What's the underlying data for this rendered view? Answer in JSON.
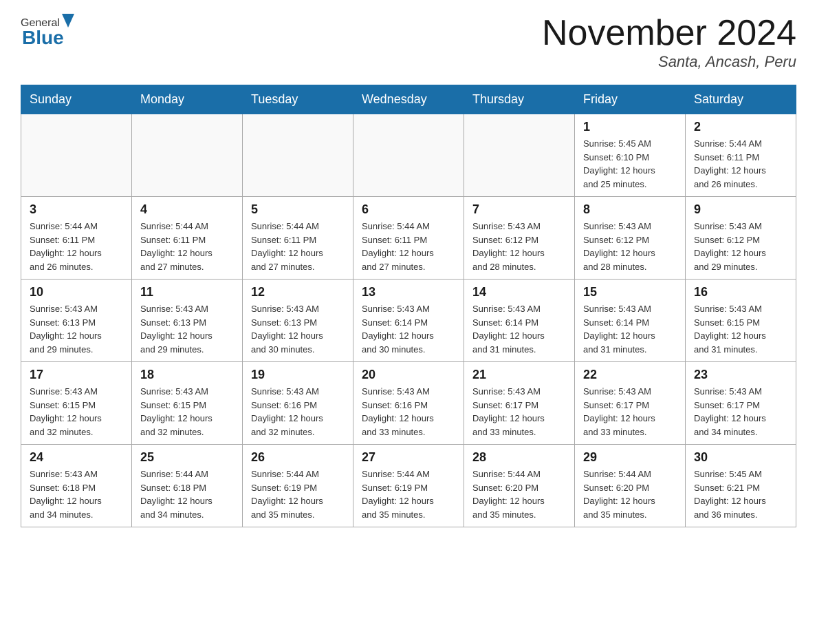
{
  "header": {
    "logo_general": "General",
    "logo_blue": "Blue",
    "month_title": "November 2024",
    "subtitle": "Santa, Ancash, Peru"
  },
  "days_of_week": [
    "Sunday",
    "Monday",
    "Tuesday",
    "Wednesday",
    "Thursday",
    "Friday",
    "Saturday"
  ],
  "weeks": [
    [
      {
        "day": "",
        "info": ""
      },
      {
        "day": "",
        "info": ""
      },
      {
        "day": "",
        "info": ""
      },
      {
        "day": "",
        "info": ""
      },
      {
        "day": "",
        "info": ""
      },
      {
        "day": "1",
        "info": "Sunrise: 5:45 AM\nSunset: 6:10 PM\nDaylight: 12 hours\nand 25 minutes."
      },
      {
        "day": "2",
        "info": "Sunrise: 5:44 AM\nSunset: 6:11 PM\nDaylight: 12 hours\nand 26 minutes."
      }
    ],
    [
      {
        "day": "3",
        "info": "Sunrise: 5:44 AM\nSunset: 6:11 PM\nDaylight: 12 hours\nand 26 minutes."
      },
      {
        "day": "4",
        "info": "Sunrise: 5:44 AM\nSunset: 6:11 PM\nDaylight: 12 hours\nand 27 minutes."
      },
      {
        "day": "5",
        "info": "Sunrise: 5:44 AM\nSunset: 6:11 PM\nDaylight: 12 hours\nand 27 minutes."
      },
      {
        "day": "6",
        "info": "Sunrise: 5:44 AM\nSunset: 6:11 PM\nDaylight: 12 hours\nand 27 minutes."
      },
      {
        "day": "7",
        "info": "Sunrise: 5:43 AM\nSunset: 6:12 PM\nDaylight: 12 hours\nand 28 minutes."
      },
      {
        "day": "8",
        "info": "Sunrise: 5:43 AM\nSunset: 6:12 PM\nDaylight: 12 hours\nand 28 minutes."
      },
      {
        "day": "9",
        "info": "Sunrise: 5:43 AM\nSunset: 6:12 PM\nDaylight: 12 hours\nand 29 minutes."
      }
    ],
    [
      {
        "day": "10",
        "info": "Sunrise: 5:43 AM\nSunset: 6:13 PM\nDaylight: 12 hours\nand 29 minutes."
      },
      {
        "day": "11",
        "info": "Sunrise: 5:43 AM\nSunset: 6:13 PM\nDaylight: 12 hours\nand 29 minutes."
      },
      {
        "day": "12",
        "info": "Sunrise: 5:43 AM\nSunset: 6:13 PM\nDaylight: 12 hours\nand 30 minutes."
      },
      {
        "day": "13",
        "info": "Sunrise: 5:43 AM\nSunset: 6:14 PM\nDaylight: 12 hours\nand 30 minutes."
      },
      {
        "day": "14",
        "info": "Sunrise: 5:43 AM\nSunset: 6:14 PM\nDaylight: 12 hours\nand 31 minutes."
      },
      {
        "day": "15",
        "info": "Sunrise: 5:43 AM\nSunset: 6:14 PM\nDaylight: 12 hours\nand 31 minutes."
      },
      {
        "day": "16",
        "info": "Sunrise: 5:43 AM\nSunset: 6:15 PM\nDaylight: 12 hours\nand 31 minutes."
      }
    ],
    [
      {
        "day": "17",
        "info": "Sunrise: 5:43 AM\nSunset: 6:15 PM\nDaylight: 12 hours\nand 32 minutes."
      },
      {
        "day": "18",
        "info": "Sunrise: 5:43 AM\nSunset: 6:15 PM\nDaylight: 12 hours\nand 32 minutes."
      },
      {
        "day": "19",
        "info": "Sunrise: 5:43 AM\nSunset: 6:16 PM\nDaylight: 12 hours\nand 32 minutes."
      },
      {
        "day": "20",
        "info": "Sunrise: 5:43 AM\nSunset: 6:16 PM\nDaylight: 12 hours\nand 33 minutes."
      },
      {
        "day": "21",
        "info": "Sunrise: 5:43 AM\nSunset: 6:17 PM\nDaylight: 12 hours\nand 33 minutes."
      },
      {
        "day": "22",
        "info": "Sunrise: 5:43 AM\nSunset: 6:17 PM\nDaylight: 12 hours\nand 33 minutes."
      },
      {
        "day": "23",
        "info": "Sunrise: 5:43 AM\nSunset: 6:17 PM\nDaylight: 12 hours\nand 34 minutes."
      }
    ],
    [
      {
        "day": "24",
        "info": "Sunrise: 5:43 AM\nSunset: 6:18 PM\nDaylight: 12 hours\nand 34 minutes."
      },
      {
        "day": "25",
        "info": "Sunrise: 5:44 AM\nSunset: 6:18 PM\nDaylight: 12 hours\nand 34 minutes."
      },
      {
        "day": "26",
        "info": "Sunrise: 5:44 AM\nSunset: 6:19 PM\nDaylight: 12 hours\nand 35 minutes."
      },
      {
        "day": "27",
        "info": "Sunrise: 5:44 AM\nSunset: 6:19 PM\nDaylight: 12 hours\nand 35 minutes."
      },
      {
        "day": "28",
        "info": "Sunrise: 5:44 AM\nSunset: 6:20 PM\nDaylight: 12 hours\nand 35 minutes."
      },
      {
        "day": "29",
        "info": "Sunrise: 5:44 AM\nSunset: 6:20 PM\nDaylight: 12 hours\nand 35 minutes."
      },
      {
        "day": "30",
        "info": "Sunrise: 5:45 AM\nSunset: 6:21 PM\nDaylight: 12 hours\nand 36 minutes."
      }
    ]
  ]
}
